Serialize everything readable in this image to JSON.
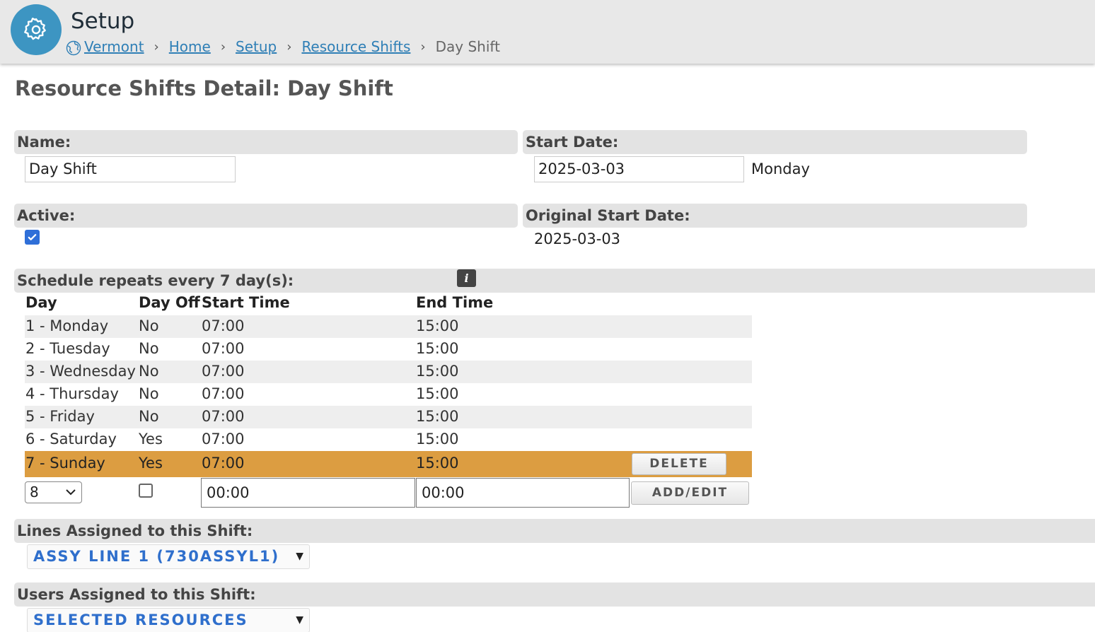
{
  "header": {
    "title": "Setup",
    "breadcrumb": {
      "site": "Vermont",
      "home": "Home",
      "setup": "Setup",
      "resource_shifts": "Resource Shifts",
      "current": "Day Shift",
      "separator": "›"
    }
  },
  "page_title": "Resource Shifts Detail: Day Shift",
  "form": {
    "name_label": "Name:",
    "name_value": "Day Shift",
    "start_date_label": "Start Date:",
    "start_date_value": "2025-03-03",
    "start_day_name": "Monday",
    "active_label": "Active:",
    "active_checked": true,
    "original_start_label": "Original Start Date:",
    "original_start_value": "2025-03-03"
  },
  "schedule": {
    "header": "Schedule repeats every 7 day(s):",
    "info_icon": "i",
    "columns": {
      "day": "Day",
      "day_off": "Day Off",
      "start": "Start Time",
      "end": "End Time"
    },
    "rows": [
      {
        "day": "1 - Monday",
        "off": "No",
        "start": "07:00",
        "end": "15:00"
      },
      {
        "day": "2 - Tuesday",
        "off": "No",
        "start": "07:00",
        "end": "15:00"
      },
      {
        "day": "3 - Wednesday",
        "off": "No",
        "start": "07:00",
        "end": "15:00"
      },
      {
        "day": "4 - Thursday",
        "off": "No",
        "start": "07:00",
        "end": "15:00"
      },
      {
        "day": "5 - Friday",
        "off": "No",
        "start": "07:00",
        "end": "15:00"
      },
      {
        "day": "6 - Saturday",
        "off": "Yes",
        "start": "07:00",
        "end": "15:00"
      },
      {
        "day": "7 - Sunday",
        "off": "Yes",
        "start": "07:00",
        "end": "15:00"
      }
    ],
    "delete_label": "DELETE",
    "new_row": {
      "day_select": "8",
      "start": "00:00",
      "end": "00:00",
      "add_label": "ADD/EDIT"
    }
  },
  "lines": {
    "header": "Lines Assigned to this Shift:",
    "dropdown": "ASSY LINE 1 (730ASSYL1)"
  },
  "users": {
    "header": "Users Assigned to this Shift:",
    "dropdown": "SELECTED RESOURCES"
  },
  "colors": {
    "accent": "#3d95c2",
    "link": "#2f7fb6",
    "selected_row": "#dc9d41",
    "dropdown_text": "#2f6fcc"
  }
}
